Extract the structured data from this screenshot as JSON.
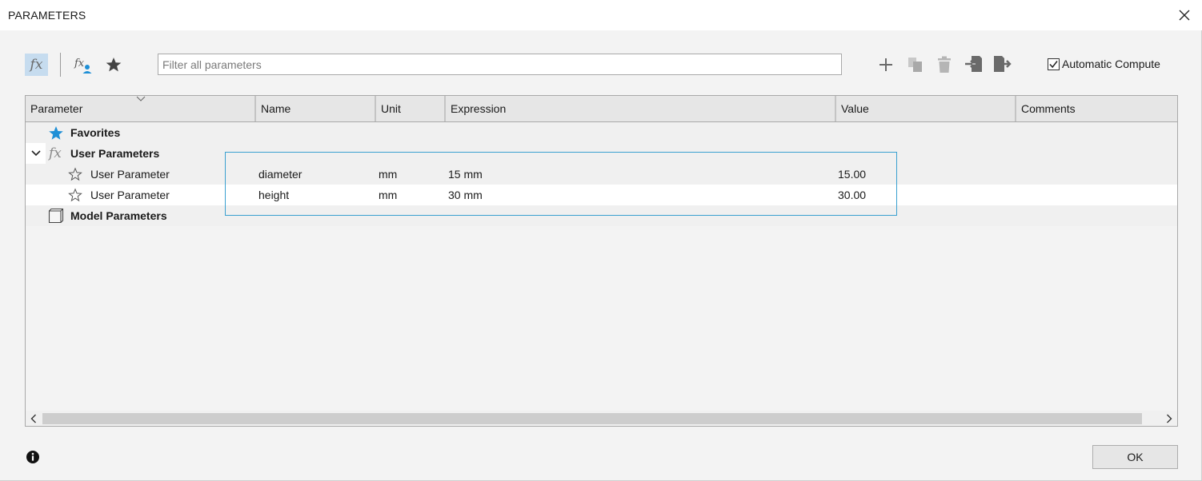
{
  "window": {
    "title": "PARAMETERS"
  },
  "toolbar": {
    "fx_label": "fx",
    "filter_placeholder": "Filter all parameters",
    "filter_value": "",
    "icons": [
      "user-parameters-filter-icon",
      "favorites-filter-icon",
      "add-icon",
      "copy-icon",
      "delete-icon",
      "import-icon",
      "export-icon"
    ],
    "auto_compute": {
      "label": "Automatic Compute",
      "checked": true
    }
  },
  "table": {
    "columns": [
      "Parameter",
      "Name",
      "Unit",
      "Expression",
      "Value",
      "Comments"
    ],
    "groups": {
      "favorites": "Favorites",
      "user": "User Parameters",
      "model": "Model Parameters"
    },
    "user_parameters": [
      {
        "parameter": "User Parameter",
        "name": "diameter",
        "unit": "mm",
        "expression": "15 mm",
        "value": "15.00",
        "comments": ""
      },
      {
        "parameter": "User Parameter",
        "name": "height",
        "unit": "mm",
        "expression": "30 mm",
        "value": "30.00",
        "comments": ""
      }
    ]
  },
  "footer": {
    "ok_label": "OK"
  },
  "colors": {
    "accent": "#1e8fd6",
    "selection_border": "#3aa0d0",
    "fx_button_bg": "#c6dcef"
  }
}
